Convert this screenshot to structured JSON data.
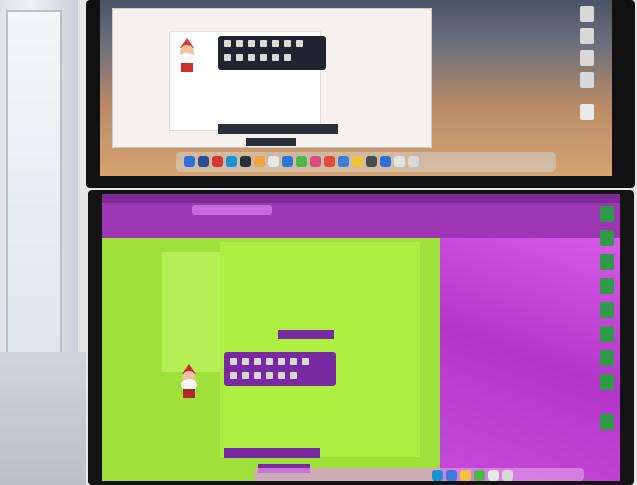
{
  "scene": {
    "description_colors": {
      "top_screen_bg": "#1c2430",
      "bottom_screen_bg": "#c441d9",
      "bottom_page_green": "#9ee13a",
      "toolbar_dark": "#20242e",
      "toolbar_purple": "#7a2aa0"
    },
    "icons": [
      "gnome-icon",
      "finder-icon",
      "safari-icon",
      "chrome-icon",
      "folder-icon",
      "trash-icon"
    ]
  }
}
